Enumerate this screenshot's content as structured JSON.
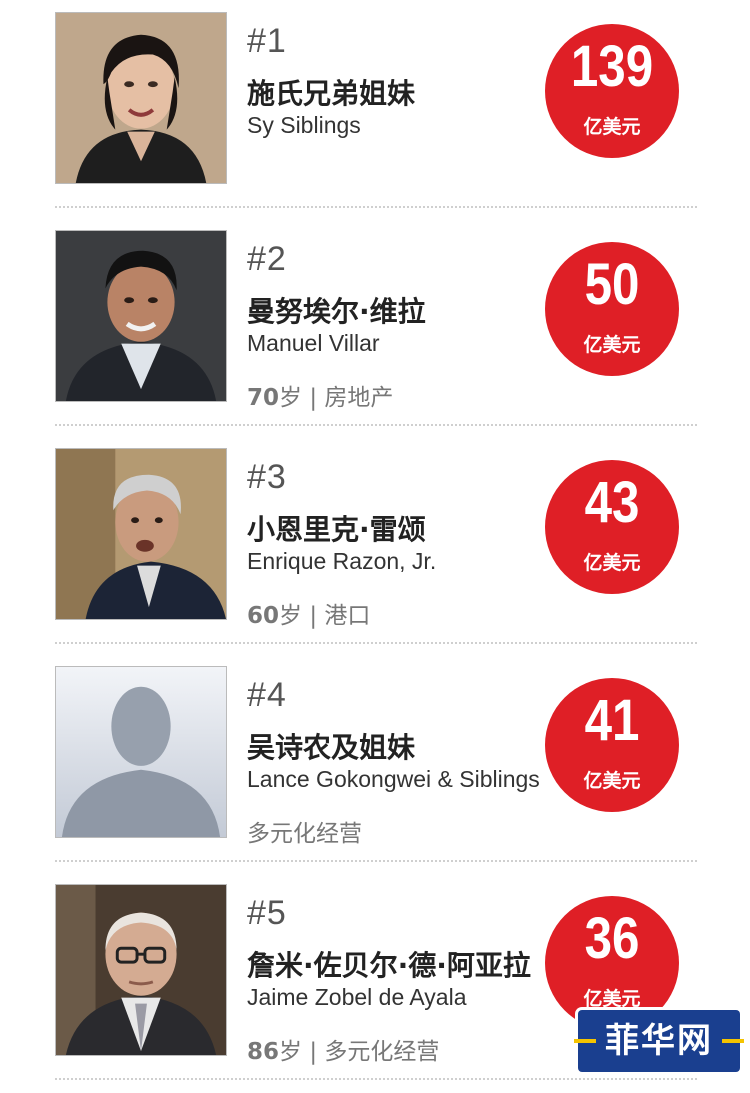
{
  "entries": [
    {
      "rank": "#1",
      "name_cn": "施氏兄弟姐妹",
      "name_en": "Sy Siblings",
      "age": "",
      "age_unit": "",
      "sep": "",
      "industry": "",
      "worth": "139",
      "unit": "亿美元"
    },
    {
      "rank": "#2",
      "name_cn": "曼努埃尔·维拉",
      "name_en": "Manuel Villar",
      "age": "70",
      "age_unit": "岁",
      "sep": " | ",
      "industry": "房地产",
      "worth": "50",
      "unit": "亿美元"
    },
    {
      "rank": "#3",
      "name_cn": "小恩里克·雷颂",
      "name_en": "Enrique Razon, Jr.",
      "age": "60",
      "age_unit": "岁",
      "sep": " | ",
      "industry": "港口",
      "worth": "43",
      "unit": "亿美元"
    },
    {
      "rank": "#4",
      "name_cn": "吴诗农及姐妹",
      "name_en": "Lance Gokongwei & Siblings",
      "age": "",
      "age_unit": "",
      "sep": "",
      "industry": "多元化经营",
      "worth": "41",
      "unit": "亿美元"
    },
    {
      "rank": "#5",
      "name_cn": "詹米·佐贝尔·德·阿亚拉",
      "name_en": "Jaime Zobel de Ayala",
      "age": "86",
      "age_unit": "岁",
      "sep": " | ",
      "industry": "多元化经营",
      "worth": "36",
      "unit": "亿美元"
    }
  ],
  "watermark": "菲华网",
  "colors": {
    "badge": "#df1f26",
    "watermark_bg": "#1a3f8f"
  }
}
